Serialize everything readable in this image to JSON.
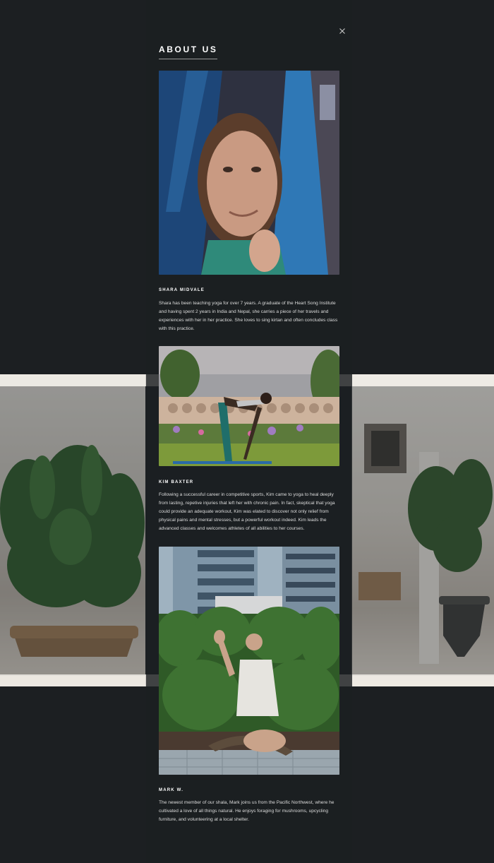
{
  "modal": {
    "title": "ABOUT US",
    "close_icon": "close-icon"
  },
  "members": [
    {
      "name": "SHARA MIDVALE",
      "bio": "Shara has been teaching yoga for over 7 years. A graduate of the Heart Song Institute and having spent 2 years in India and Nepal, she carries a piece of her travels and experiences with her in her practice. She loves to sing kirtan and often concludes class with this practice."
    },
    {
      "name": "KIM BAXTER",
      "bio": "Following a successful career in competitive sports, Kim came to yoga to heal deeply from lasting, repetive injuries that left her with chronic pain. In fact, skeptical that yoga could provide an adequate workout, Kim was elated to discover not only relief from physical pains and mental stresses, but a powerful workout indeed. Kim leads the advanced classes and welcomes athletes of all abilities to her courses."
    },
    {
      "name": "MARK W.",
      "bio": "The newest member of our shala, Mark joins us from the Pacific Northwest, where he cultivated a love of all things natural. He enjoys foraging for mushrooms, upcycling furniture, and volunteering at a local shelter."
    }
  ],
  "colors": {
    "background": "#1c1f22",
    "text": "#dcdcdc",
    "heading": "#ffffff"
  }
}
